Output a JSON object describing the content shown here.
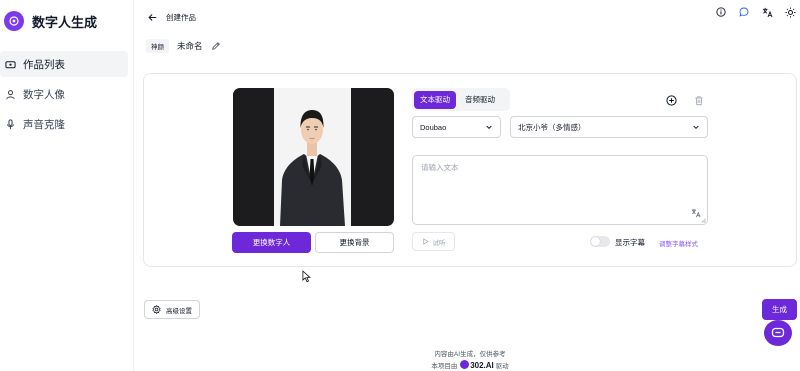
{
  "app": {
    "title": "数字人生成"
  },
  "sidebar": {
    "items": [
      {
        "label": "作品列表",
        "icon": "video-icon",
        "active": true
      },
      {
        "label": "数字人像",
        "icon": "user-icon",
        "active": false
      },
      {
        "label": "声音克隆",
        "icon": "microphone-icon",
        "active": false
      }
    ]
  },
  "header": {
    "back_label": "创建作品",
    "icons": [
      "info-icon",
      "chat-bubble-icon",
      "translate-icon",
      "sun-icon"
    ]
  },
  "work": {
    "tag": "神颜",
    "name": "未命名"
  },
  "preview": {
    "change_avatar_label": "更换数字人",
    "change_background_label": "更换背景"
  },
  "drive": {
    "tabs": [
      {
        "label": "文本驱动",
        "active": true
      },
      {
        "label": "音频驱动",
        "active": false
      }
    ],
    "model_select": "Doubao",
    "voice_select": "北京小爷（多情感）",
    "text_placeholder": "请输入文本",
    "listen_label": "试听",
    "subtitle_label": "显示字幕",
    "subtitle_style_label": "调整字幕样式",
    "subtitle_enabled": false
  },
  "actions": {
    "advanced_label": "高级设置",
    "generate_label": "生成"
  },
  "footer": {
    "line1": "内容由AI生成，仅供参考",
    "line2_prefix": "本项目由",
    "line2_brand": "302.AI",
    "line2_suffix": "驱动"
  },
  "colors": {
    "accent": "#6d28d9",
    "link": "#8b5cf6"
  }
}
